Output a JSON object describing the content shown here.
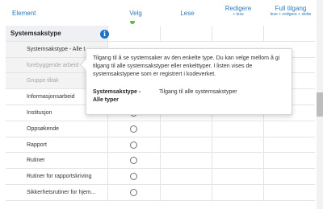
{
  "header": {
    "element": "Element",
    "velg": "Velg",
    "lese": "Lese",
    "redigere": "Redigere",
    "redigere_sub": "+ lese",
    "full": "Full tilgang",
    "full_sub": "lese + redigere + slette"
  },
  "section": {
    "title": "Systemsakstype",
    "info_icon": "i"
  },
  "rows": [
    "Systemsakstype - Alle t",
    "forebyggende arbeid",
    "Gruppe tiltak",
    "Informasjonsarbeid",
    "Institusjon",
    "Oppsøkende",
    "Rapport",
    "Rutiner",
    "Rutiner for rapportskriving",
    "Sikkerhetsrutiner for hjem..."
  ],
  "tooltip": {
    "text": "Tilgang til å se systemsaker av den enkelte type. Du kan velge mellom å gi tilgang til alle systemsakstyper eller enkelttyper. I listen vises de systemsakstypene som er registrert i kodeverket.",
    "term": "Systemsakstype - Alle typer",
    "definition": "Tilgang til alle systemsakstyper"
  },
  "colors": {
    "link": "#2e7ab8",
    "info": "#1e6fc9",
    "selected": "#55c24a"
  }
}
